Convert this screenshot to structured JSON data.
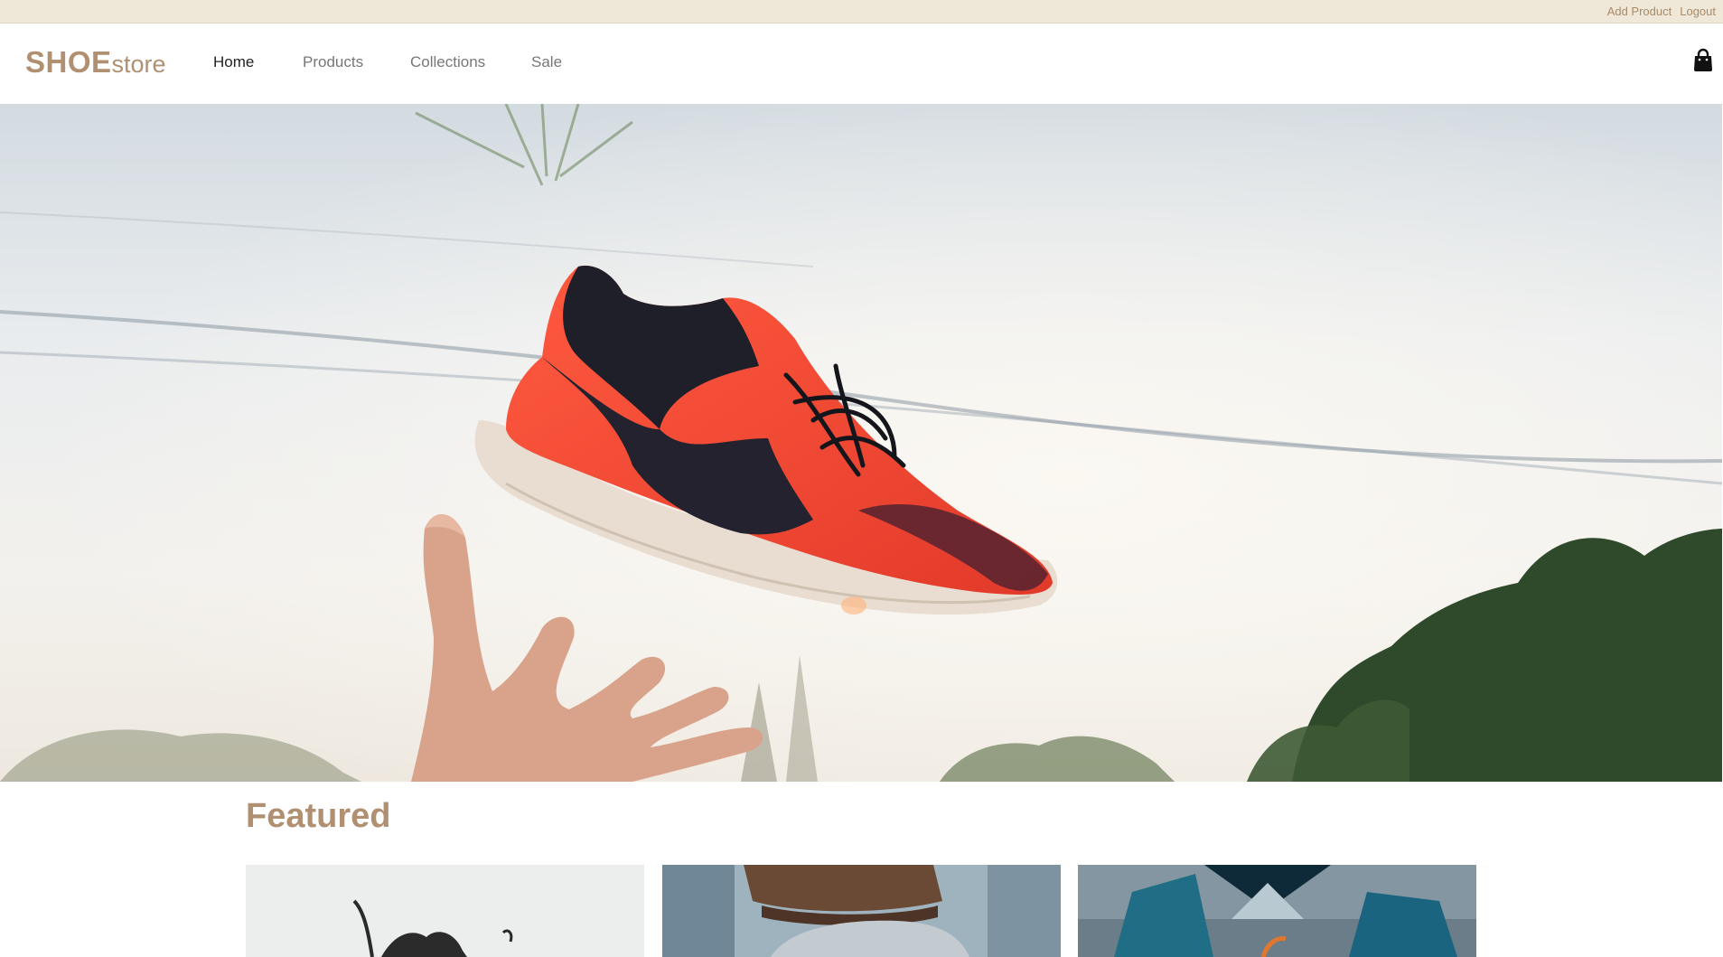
{
  "topbar": {
    "links": [
      "Add Product",
      "Logout"
    ]
  },
  "brand": {
    "bold": "SHOE",
    "light": "store"
  },
  "nav": {
    "items": [
      "Home",
      "Products",
      "Collections",
      "Sale"
    ],
    "active": "Home"
  },
  "icons": {
    "cart": "shopping-bag-icon"
  },
  "colors": {
    "accent": "#b09071",
    "topbar_bg": "#efe8d8",
    "link": "#a88a67"
  },
  "featured": {
    "title": "Featured"
  }
}
